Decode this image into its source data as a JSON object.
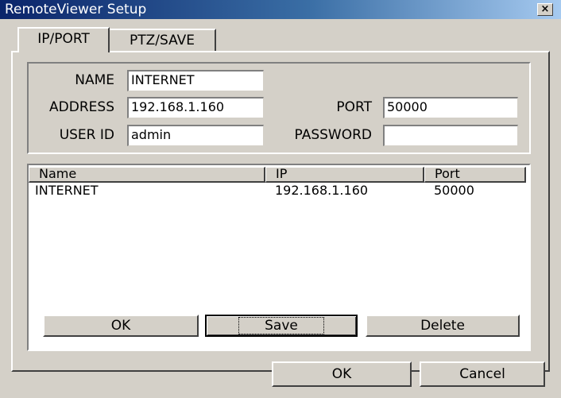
{
  "window": {
    "title": "RemoteViewer Setup",
    "close_glyph": "×",
    "close_icon": "close-icon"
  },
  "tabs": [
    {
      "label": "IP/PORT",
      "active": true
    },
    {
      "label": "PTZ/SAVE",
      "active": false
    }
  ],
  "form": {
    "name_label": "NAME",
    "name_value": "INTERNET",
    "address_label": "ADDRESS",
    "address_value": "192.168.1.160",
    "port_label": "PORT",
    "port_value": "50000",
    "userid_label": "USER ID",
    "userid_value": "admin",
    "password_label": "PASSWORD",
    "password_value": ""
  },
  "list": {
    "columns": [
      "Name",
      "IP",
      "Port"
    ],
    "rows": [
      {
        "name": "INTERNET",
        "ip": "192.168.1.160",
        "port": "50000"
      }
    ]
  },
  "panel_buttons": {
    "ok": "OK",
    "save": "Save",
    "delete": "Delete"
  },
  "dialog_buttons": {
    "ok": "OK",
    "cancel": "Cancel"
  }
}
